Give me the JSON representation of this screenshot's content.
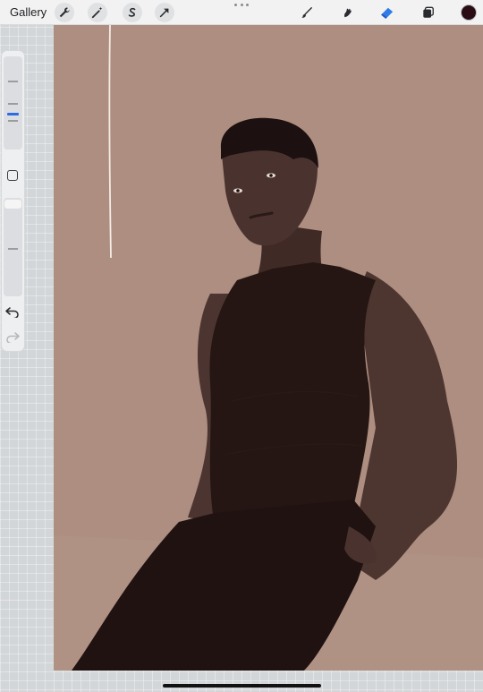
{
  "topbar": {
    "gallery_label": "Gallery",
    "left_tools": [
      {
        "icon": "wrench-icon",
        "name": "actions"
      },
      {
        "icon": "magic-wand-icon",
        "name": "adjustments"
      },
      {
        "icon": "selection-s-icon",
        "name": "selection"
      },
      {
        "icon": "transform-arrow-icon",
        "name": "transform"
      }
    ],
    "right_tools": [
      {
        "icon": "brush-icon",
        "name": "paint"
      },
      {
        "icon": "smudge-icon",
        "name": "smudge"
      },
      {
        "icon": "eraser-icon",
        "name": "erase",
        "active": true
      },
      {
        "icon": "layers-icon",
        "name": "layers"
      }
    ],
    "current_color": "#2a0d14",
    "active_tool_color": "#2f7be8"
  },
  "sidebar": {
    "brush_size_level": 0.62,
    "opacity_level": 0.05,
    "modify_icon": "square-icon",
    "undo_icon": "undo-icon",
    "redo_icon": "redo-icon"
  },
  "canvas": {
    "background_color": "#ad8e80",
    "subject_colors": {
      "skin": "#4e3630",
      "clothing": "#251614",
      "hair": "#1a1010"
    }
  }
}
